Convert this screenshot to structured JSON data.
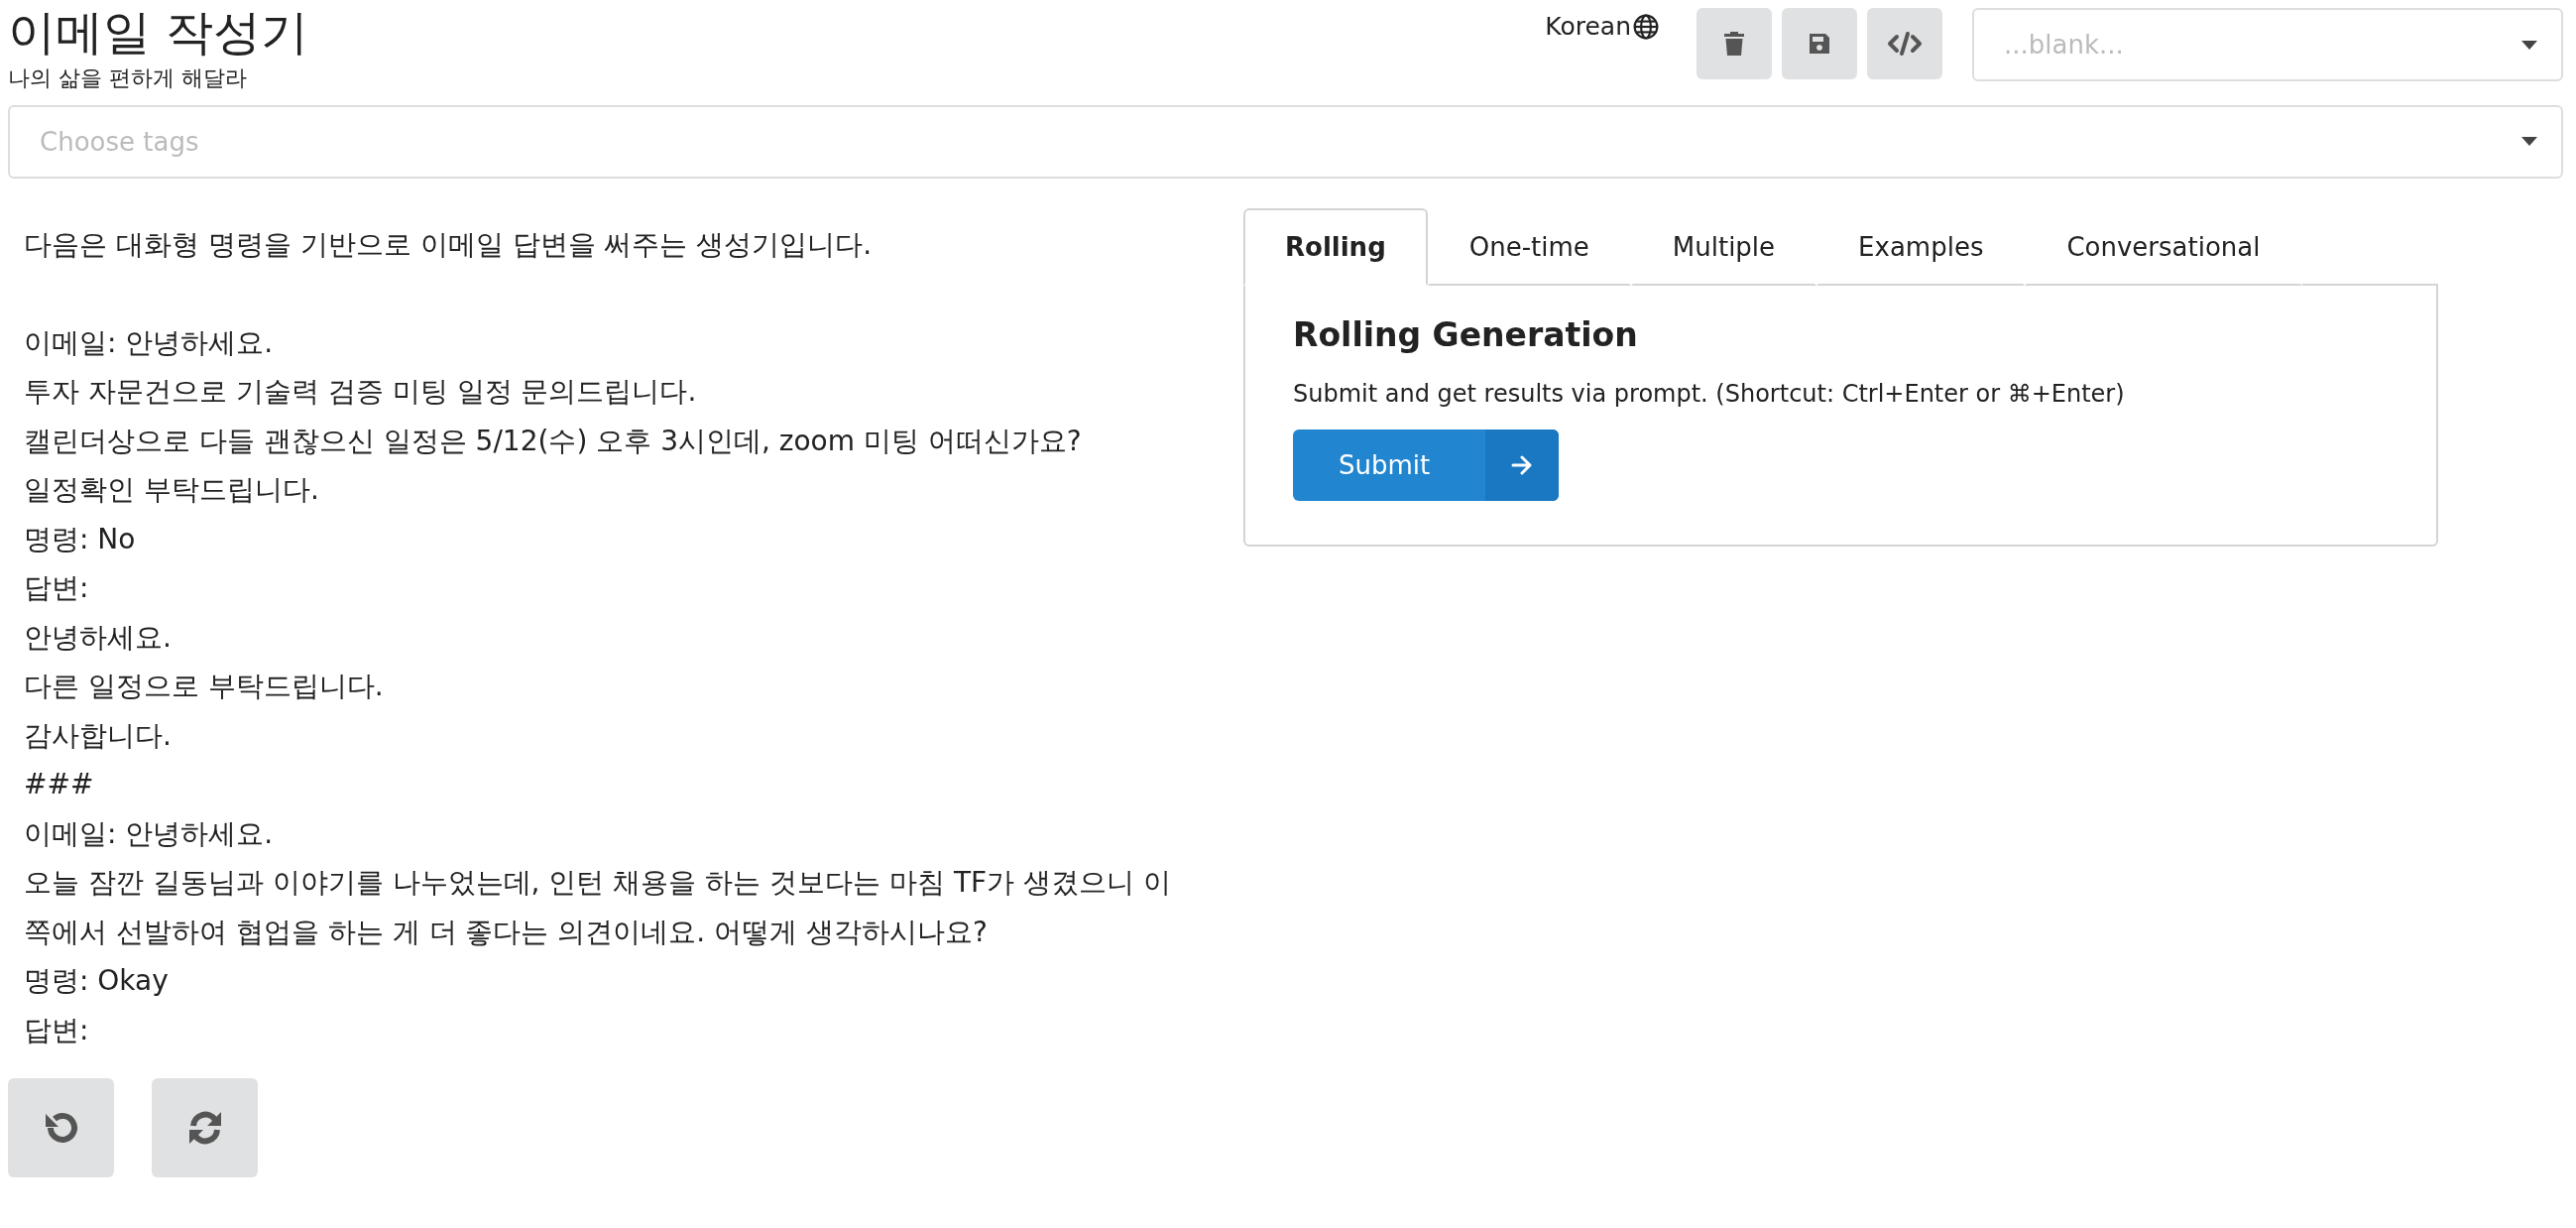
{
  "header": {
    "title": "이메일 작성기",
    "subtitle": "나의 삶을 편하게 해달라",
    "language": "Korean",
    "preset_select": {
      "placeholder": "...blank..."
    }
  },
  "tags": {
    "placeholder": "Choose tags"
  },
  "prompt": {
    "value": "다음은 대화형 명령을 기반으로 이메일 답변을 써주는 생성기입니다.\n\n이메일: 안녕하세요.\n투자 자문건으로 기술력 검증 미팅 일정 문의드립니다.\n캘린더상으로 다들 괜찮으신 일정은 5/12(수) 오후 3시인데, zoom 미팅 어떠신가요?\n일정확인 부탁드립니다.\n명령: No\n답변:\n안녕하세요.\n다른 일정으로 부탁드립니다.\n감사합니다.\n###\n이메일: 안녕하세요.\n오늘 잠깐 길동님과 이야기를 나누었는데, 인턴 채용을 하는 것보다는 마침 TF가 생겼으니 이쪽에서 선발하여 협업을 하는 게 더 좋다는 의견이네요. 어떻게 생각하시나요?\n명령: Okay\n답변:"
  },
  "tabs": [
    {
      "label": "Rolling",
      "selected": true
    },
    {
      "label": "One-time",
      "selected": false
    },
    {
      "label": "Multiple",
      "selected": false
    },
    {
      "label": "Examples",
      "selected": false
    },
    {
      "label": "Conversational",
      "selected": false
    }
  ],
  "panel": {
    "heading": "Rolling Generation",
    "description": "Submit and get results via prompt. (Shortcut: Ctrl+Enter or ⌘+Enter)",
    "submit_label": "Submit"
  }
}
